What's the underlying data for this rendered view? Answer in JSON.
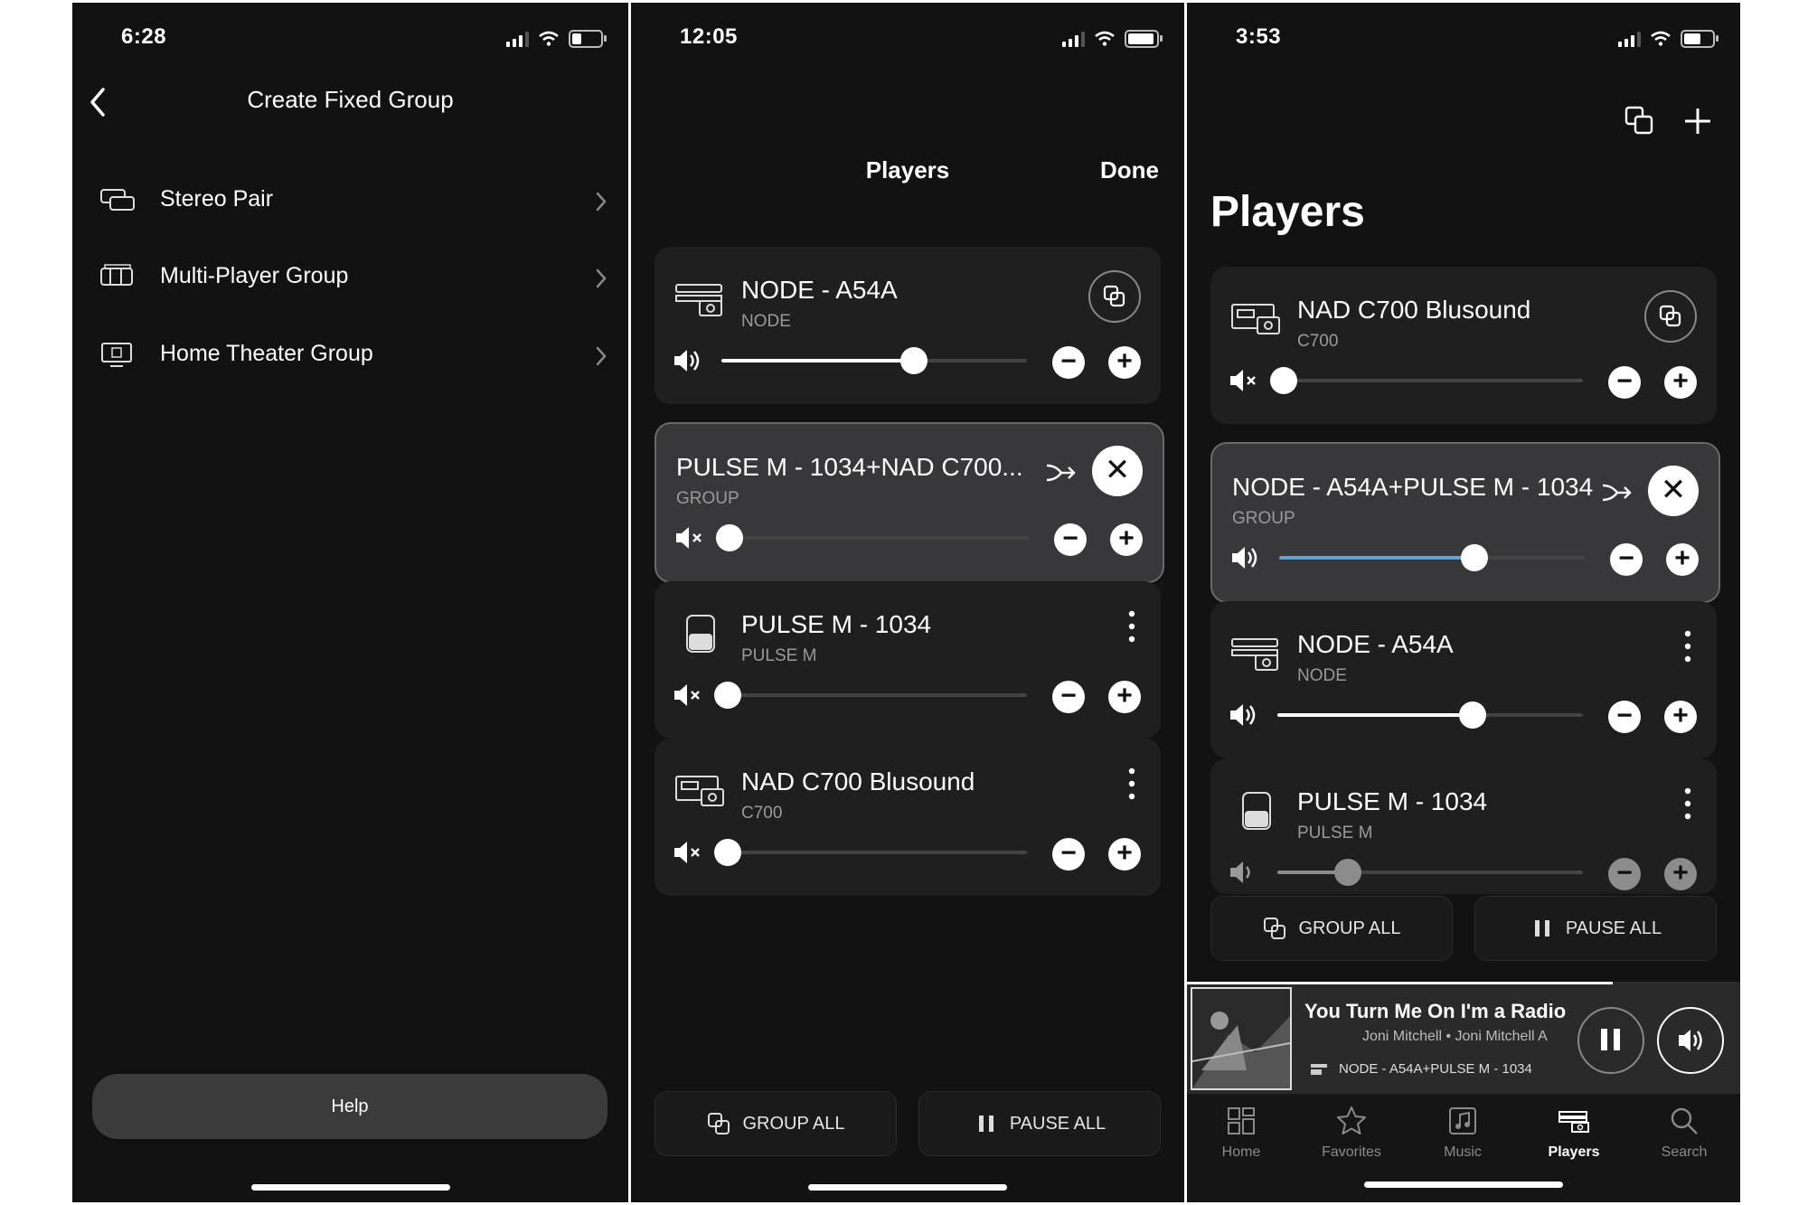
{
  "screen1": {
    "status_time": "6:28",
    "title": "Create Fixed Group",
    "items": [
      {
        "label": "Stereo Pair"
      },
      {
        "label": "Multi-Player Group"
      },
      {
        "label": "Home Theater Group"
      }
    ],
    "help_label": "Help"
  },
  "screen2": {
    "status_time": "12:05",
    "header_title": "Players",
    "done_label": "Done",
    "cards": [
      {
        "name": "NODE - A54A",
        "sub": "NODE",
        "volume": 0.63,
        "muted": false
      },
      {
        "name": "PULSE M - 1034+NAD  C700...",
        "sub": "GROUP",
        "volume": 0.02,
        "muted": true
      },
      {
        "name": "PULSE M - 1034",
        "sub": "PULSE M",
        "volume": 0.02,
        "muted": true
      },
      {
        "name": "NAD  C700 Blusound",
        "sub": "C700",
        "volume": 0.02,
        "muted": true
      }
    ],
    "group_all_label": "GROUP ALL",
    "pause_all_label": "PAUSE ALL"
  },
  "screen3": {
    "status_time": "3:53",
    "title": "Players",
    "cards": [
      {
        "name": "NAD  C700 Blusound",
        "sub": "C700",
        "volume": 0.02,
        "muted": true
      },
      {
        "name": "NODE - A54A+PULSE M - 1034",
        "sub": "GROUP",
        "volume": 0.64,
        "muted": false
      },
      {
        "name": "NODE - A54A",
        "sub": "NODE",
        "volume": 0.64,
        "muted": false
      },
      {
        "name": "PULSE M - 1034",
        "sub": "PULSE M",
        "volume": 0.23,
        "muted": false
      }
    ],
    "group_all_label": "GROUP ALL",
    "pause_all_label": "PAUSE ALL",
    "now_playing": {
      "title": "You Turn Me On I'm a Radio",
      "artist": "Joni Mitchell • Joni Mitchell A",
      "device": "NODE - A54A+PULSE M - 1034",
      "progress": 0.77
    },
    "tabs": [
      {
        "label": "Home"
      },
      {
        "label": "Favorites"
      },
      {
        "label": "Music"
      },
      {
        "label": "Players"
      },
      {
        "label": "Search"
      }
    ],
    "active_tab": "Players"
  },
  "colors": {
    "background": "#121212",
    "card": "#1f1f1f",
    "card_highlight": "#38383a",
    "accent_blue": "#5aa6d6",
    "muted_text": "#9a9a9a"
  }
}
